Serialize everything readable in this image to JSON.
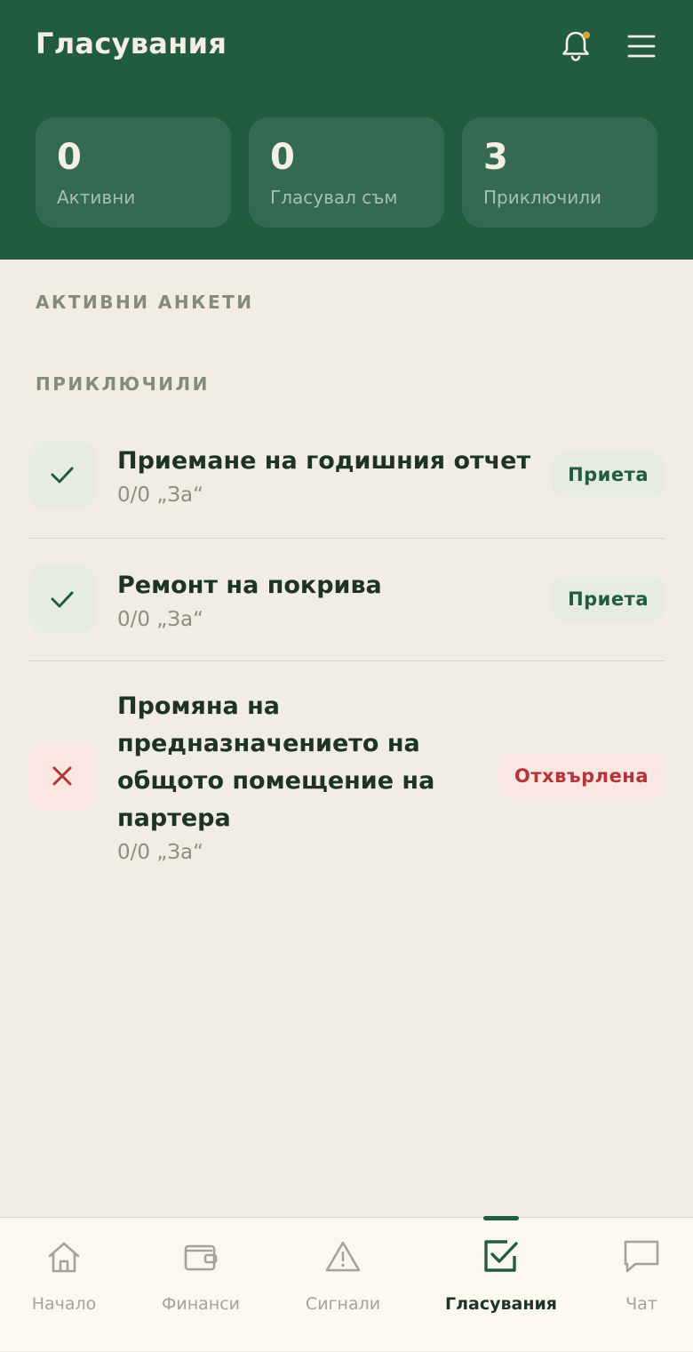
{
  "header": {
    "title": "Гласувания",
    "stats": [
      {
        "value": "0",
        "label": "Активни"
      },
      {
        "value": "0",
        "label": "Гласувал съм"
      },
      {
        "value": "3",
        "label": "Приключили"
      }
    ]
  },
  "sections": {
    "active_label": "АКТИВНИ АНКЕТИ",
    "finished_label": "ПРИКЛЮЧИЛИ"
  },
  "polls": [
    {
      "title": "Приемане на годишния отчет",
      "result": "0/0 „За“",
      "status": "Приета",
      "outcome": "accepted"
    },
    {
      "title": "Ремонт на покрива",
      "result": "0/0 „За“",
      "status": "Приета",
      "outcome": "accepted"
    },
    {
      "title": "Промяна на предназначението на общото помещение на партера",
      "result": "0/0 „За“",
      "status": "Отхвърлена",
      "outcome": "rejected"
    }
  ],
  "nav": {
    "items": [
      {
        "label": "Начало",
        "icon": "home-icon"
      },
      {
        "label": "Финанси",
        "icon": "wallet-icon"
      },
      {
        "label": "Сигнали",
        "icon": "warning-icon"
      },
      {
        "label": "Гласувания",
        "icon": "checkbox-icon"
      },
      {
        "label": "Чат",
        "icon": "chat-icon"
      }
    ],
    "active_index": 3
  },
  "colors": {
    "brand": "#215c41",
    "background": "#f1ede2",
    "notification_dot": "#d4a63a",
    "accepted": "#215c41",
    "rejected": "#b3353a"
  }
}
